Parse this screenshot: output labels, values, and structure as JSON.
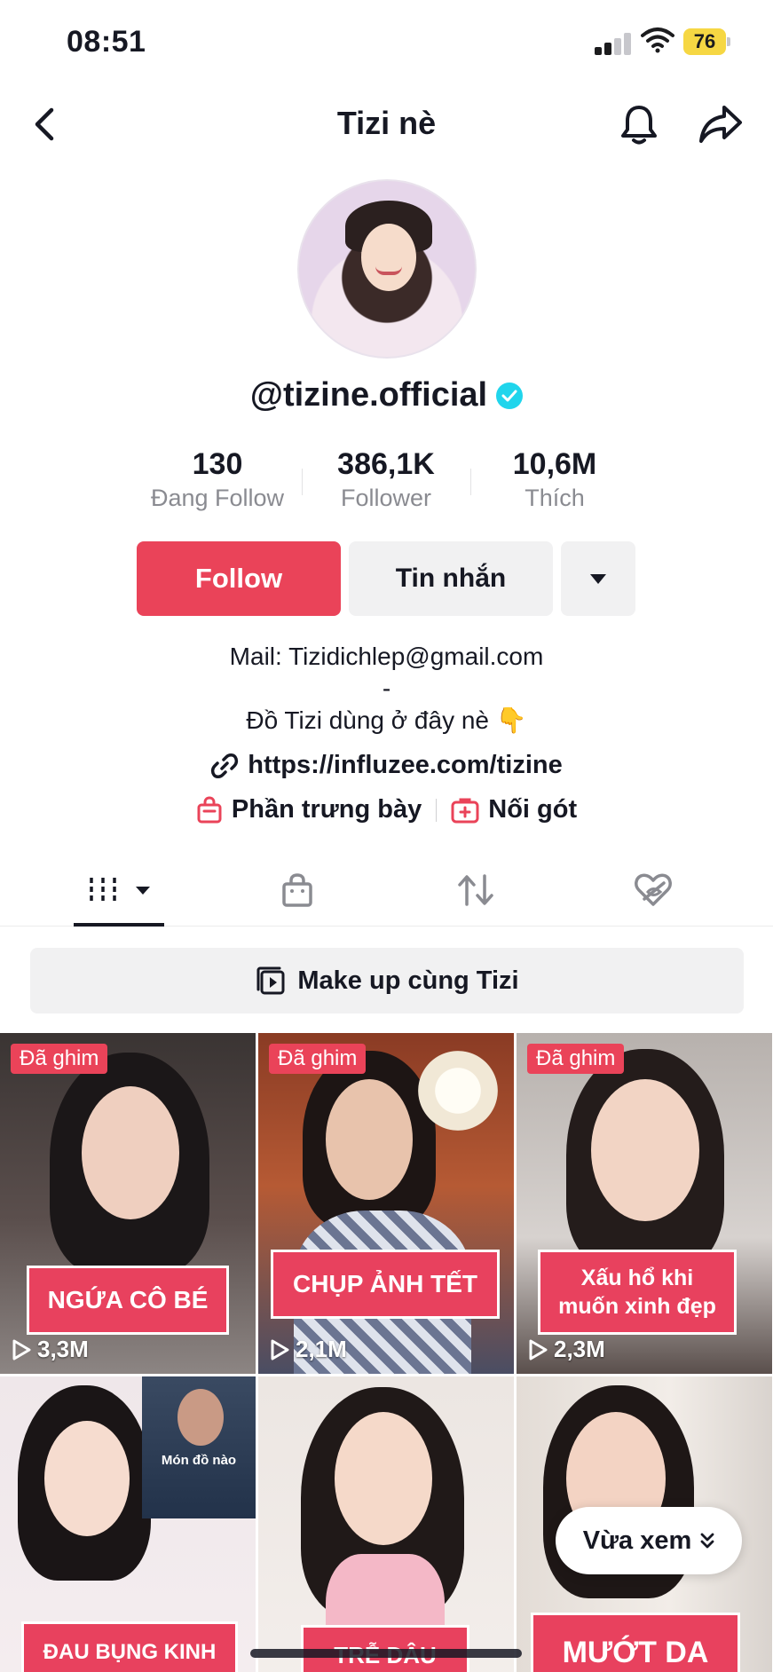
{
  "status_bar": {
    "time": "08:51",
    "battery": "76"
  },
  "header": {
    "title": "Tizi nè"
  },
  "profile": {
    "username": "@tizine.official",
    "stats": [
      {
        "value": "130",
        "label": "Đang Follow"
      },
      {
        "value": "386,1K",
        "label": "Follower"
      },
      {
        "value": "10,6M",
        "label": "Thích"
      }
    ]
  },
  "actions": {
    "follow": "Follow",
    "message": "Tin nhắn"
  },
  "bio": {
    "line1": "Mail: Tizidichlep@gmail.com",
    "line2": "-",
    "line3": "Đồ Tizi dùng ở đây nè 👇",
    "link": "https://influzee.com/tizine",
    "showcase": "Phần trưng bày",
    "heels": "Nối gót"
  },
  "playlist": {
    "label": "Make up cùng Tizi"
  },
  "videos": [
    {
      "pinned": "Đã ghim",
      "caption": "NGỨA CÔ BÉ",
      "plays": "3,3M"
    },
    {
      "pinned": "Đã ghim",
      "caption": "CHỤP ẢNH TẾT",
      "plays": "2,1M"
    },
    {
      "pinned": "Đã ghim",
      "caption": "Xấu hổ khi muốn xinh đẹp",
      "plays": "2,3M"
    },
    {
      "caption": "ĐAU BỤNG KINH",
      "overlay": "Món đồ nào"
    },
    {
      "caption": "TRỄ DÂU"
    },
    {
      "caption": "MƯỚT DA"
    }
  ],
  "recent": {
    "label": "Vừa xem"
  },
  "colors": {
    "accent": "#ea4359",
    "verified": "#20d5ec",
    "text": "#161823",
    "muted": "#8a8b91"
  },
  "icons": [
    "back-icon",
    "bell-icon",
    "share-icon",
    "verified-icon",
    "chevron-down-icon",
    "link-icon",
    "bag-icon",
    "gift-icon",
    "grid-icon",
    "shop-tab-icon",
    "repost-icon",
    "liked-hidden-icon",
    "playlist-icon",
    "play-icon",
    "double-chevron-icon"
  ]
}
